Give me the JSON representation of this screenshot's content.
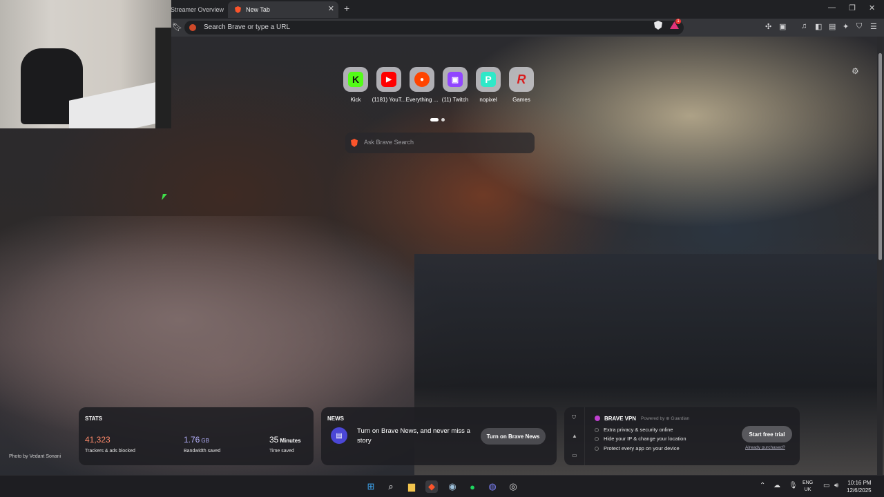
{
  "browser": {
    "tabs": [
      {
        "label": "Streamer Overview &"
      },
      {
        "label": "New Tab",
        "active": true
      }
    ],
    "omnibox_placeholder": "Search Brave or type a URL",
    "rewards_badge": "1",
    "new_tab_symbol": "+",
    "close_symbol": "✕",
    "window_controls": {
      "minimize": "—",
      "maximize": "❐",
      "close": "✕"
    }
  },
  "newtab": {
    "top_sites": [
      {
        "label": "Kick",
        "glyph": "K",
        "color": "#53fc18",
        "fg": "#111"
      },
      {
        "label": "(1181) YouT...",
        "glyph": "▶",
        "color": "#ff0000",
        "fg": "#fff"
      },
      {
        "label": "Everything ...",
        "glyph": "●",
        "color": "#ff4500",
        "fg": "#fff"
      },
      {
        "label": "(11) Twitch",
        "glyph": "▣",
        "color": "#9146ff",
        "fg": "#fff"
      },
      {
        "label": "nopixel",
        "glyph": "P",
        "color": "#2ee8c8",
        "fg": "#fff"
      },
      {
        "label": "Games",
        "glyph": "R",
        "color": "#d91e1e",
        "fg": "#fff"
      }
    ],
    "ask_placeholder": "Ask Brave Search",
    "photo_credit": "Photo by Vedant Sonani",
    "stats": {
      "title": "STATS",
      "trackers": {
        "value": "41,323",
        "desc": "Trackers & ads blocked",
        "color": "#ff8a6b"
      },
      "bandwidth": {
        "value": "1.76",
        "unit": "GB",
        "desc": "Bandwidth saved",
        "color": "#b6b2ff"
      },
      "time": {
        "value": "35",
        "unit": "Minutes",
        "desc": "Time saved",
        "color": "#ffffff"
      }
    },
    "news": {
      "title": "NEWS",
      "text": "Turn on Brave News, and never miss a story",
      "button": "Turn on Brave News"
    },
    "vpn": {
      "title": "BRAVE VPN",
      "powered_by": "Powered by ⊕ Guardian",
      "features": [
        "Extra privacy & security online",
        "Hide your IP & change your location",
        "Protect every app on your device"
      ],
      "button": "Start free trial",
      "link": "Already purchased?"
    }
  },
  "taskbar": {
    "apps": [
      {
        "name": "start",
        "glyph": "⊞",
        "color": "#3fa9f5"
      },
      {
        "name": "search",
        "glyph": "⌕",
        "color": "#ffffff"
      },
      {
        "name": "file-explorer",
        "glyph": "▆",
        "color": "#f2c44d"
      },
      {
        "name": "brave",
        "glyph": "◆",
        "color": "#fb542b"
      },
      {
        "name": "steam",
        "glyph": "◉",
        "color": "#9ec0da"
      },
      {
        "name": "spotify",
        "glyph": "●",
        "color": "#1ed760"
      },
      {
        "name": "discord",
        "glyph": "◍",
        "color": "#7b7ff5"
      },
      {
        "name": "obs",
        "glyph": "◎",
        "color": "#dddddd"
      }
    ],
    "language": {
      "line1": "ENG",
      "line2": "UK"
    },
    "time": "10:16 PM",
    "date": "12/6/2025"
  }
}
